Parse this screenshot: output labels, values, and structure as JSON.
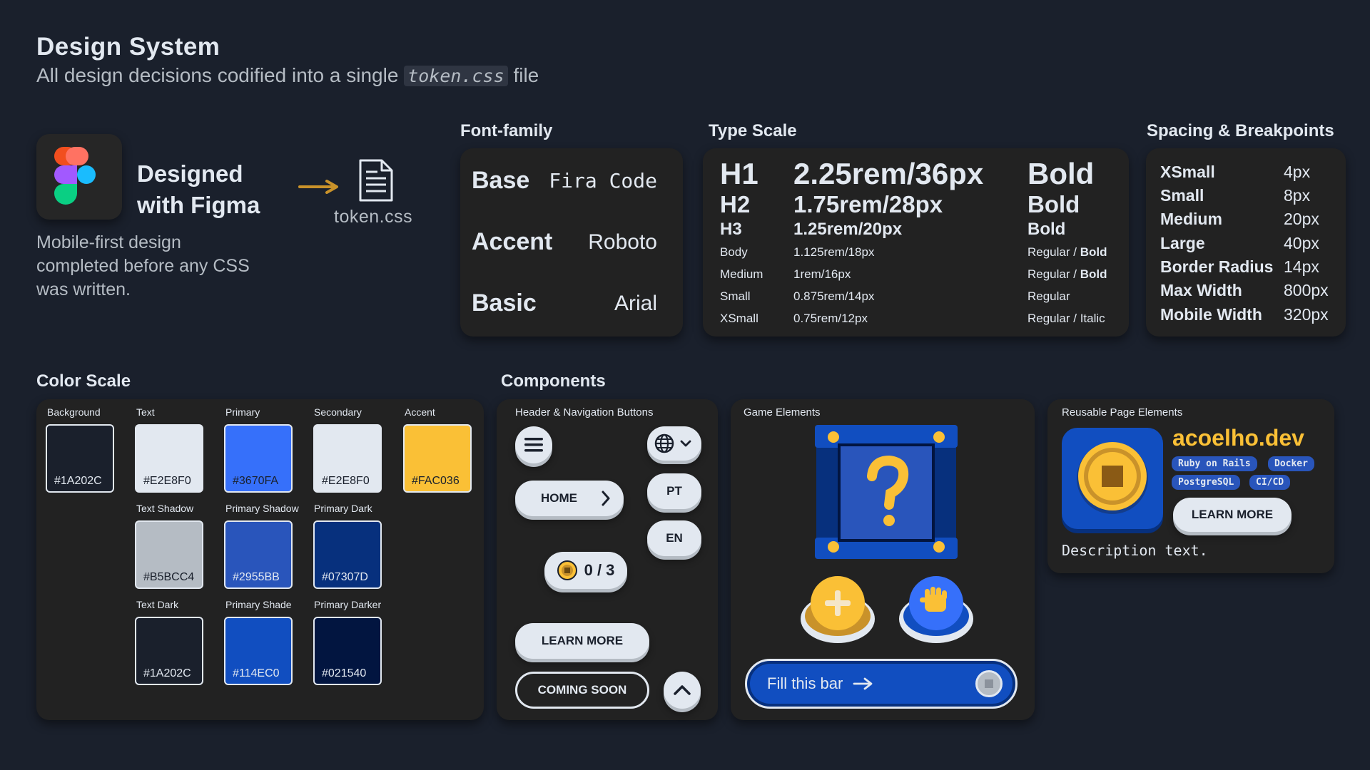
{
  "header": {
    "title": "Design System",
    "subtitle_before": "All design decisions codified into a single",
    "subtitle_code": "token.css",
    "subtitle_after": "file"
  },
  "figma": {
    "heading_line1": "Designed",
    "heading_line2": "with Figma",
    "file_label": "token.css",
    "description": "Mobile-first design completed before any CSS was written."
  },
  "font_family": {
    "title": "Font-family",
    "rows": [
      {
        "name": "Base",
        "value": "Fira Code"
      },
      {
        "name": "Accent",
        "value": "Roboto"
      },
      {
        "name": "Basic",
        "value": "Arial"
      }
    ]
  },
  "type_scale": {
    "title": "Type Scale",
    "rows": [
      {
        "name": "H1",
        "size": "2.25rem/36px",
        "weight": "Bold",
        "weight_bold": ""
      },
      {
        "name": "H2",
        "size": "1.75rem/28px",
        "weight": "Bold",
        "weight_bold": ""
      },
      {
        "name": "H3",
        "size": "1.25rem/20px",
        "weight": "Bold",
        "weight_bold": ""
      },
      {
        "name": "Body",
        "size": "1.125rem/18px",
        "weight": "Regular / ",
        "weight_bold": "Bold"
      },
      {
        "name": "Medium",
        "size": "1rem/16px",
        "weight": "Regular / ",
        "weight_bold": "Bold"
      },
      {
        "name": "Small",
        "size": "0.875rem/14px",
        "weight": "Regular",
        "weight_bold": ""
      },
      {
        "name": "XSmall",
        "size": "0.75rem/12px",
        "weight": "Regular / Italic",
        "weight_bold": ""
      }
    ]
  },
  "spacing": {
    "title": "Spacing & Breakpoints",
    "rows": [
      {
        "name": "XSmall",
        "value": "4px"
      },
      {
        "name": "Small",
        "value": "8px"
      },
      {
        "name": "Medium",
        "value": "20px"
      },
      {
        "name": "Large",
        "value": "40px"
      },
      {
        "name": "Border Radius",
        "value": "14px"
      },
      {
        "name": "Max Width",
        "value": "800px"
      },
      {
        "name": "Mobile Width",
        "value": "320px"
      }
    ]
  },
  "color_scale": {
    "title": "Color Scale",
    "swatches": [
      {
        "label": "Background",
        "hex": "#1A202C",
        "color": "#1A202C",
        "text_color": "#E2E8F0"
      },
      {
        "label": "Text",
        "hex": "#E2E8F0",
        "color": "#E2E8F0",
        "text_color": "#1A202C"
      },
      {
        "label": "Primary",
        "hex": "#3670FA",
        "color": "#3670FA",
        "text_color": "#1A202C"
      },
      {
        "label": "Secondary",
        "hex": "#E2E8F0",
        "color": "#E2E8F0",
        "text_color": "#1A202C"
      },
      {
        "label": "Accent",
        "hex": "#FAC036",
        "color": "#FAC036",
        "text_color": "#1A202C"
      },
      {
        "label": "Text Shadow",
        "hex": "#B5BCC4",
        "color": "#B5BCC4",
        "text_color": "#1A202C"
      },
      {
        "label": "Primary Shadow",
        "hex": "#2955BB",
        "color": "#2955BB",
        "text_color": "#E2E8F0"
      },
      {
        "label": "Primary Dark",
        "hex": "#07307D",
        "color": "#07307D",
        "text_color": "#E2E8F0"
      },
      {
        "label": "Text Dark",
        "hex": "#1A202C",
        "color": "#1A202C",
        "text_color": "#E2E8F0"
      },
      {
        "label": "Primary Shade",
        "hex": "#114EC0",
        "color": "#114EC0",
        "text_color": "#E2E8F0"
      },
      {
        "label": "Primary Darker",
        "hex": "#021540",
        "color": "#021540",
        "text_color": "#E2E8F0"
      }
    ]
  },
  "components": {
    "title": "Components",
    "nav_label": "Header & Navigation Buttons",
    "home": "HOME",
    "lang_pt": "PT",
    "lang_en": "EN",
    "counter": "0 / 3",
    "learn_more": "LEARN MORE",
    "coming_soon": "COMING SOON",
    "icons": [
      "hamburger-menu-icon",
      "globe-icon",
      "chevron-down-icon",
      "chevron-right-icon",
      "coin-icon",
      "chevron-up-icon"
    ]
  },
  "game": {
    "label": "Game Elements",
    "fill_bar_text": "Fill this bar",
    "icons": [
      "question-block-icon",
      "plus-icon",
      "fist-icon",
      "arrow-right-icon"
    ]
  },
  "reusable": {
    "label": "Reusable Page Elements",
    "site_name": "acoelho.dev",
    "tags": [
      "Ruby on Rails",
      "Docker",
      "PostgreSQL",
      "CI/CD"
    ],
    "learn_more": "LEARN MORE",
    "description": "Description text."
  },
  "colors": {
    "background": "#1A202C",
    "text": "#E2E8F0",
    "primary": "#3670FA",
    "accent": "#FAC036",
    "primary_dark": "#07307D"
  }
}
